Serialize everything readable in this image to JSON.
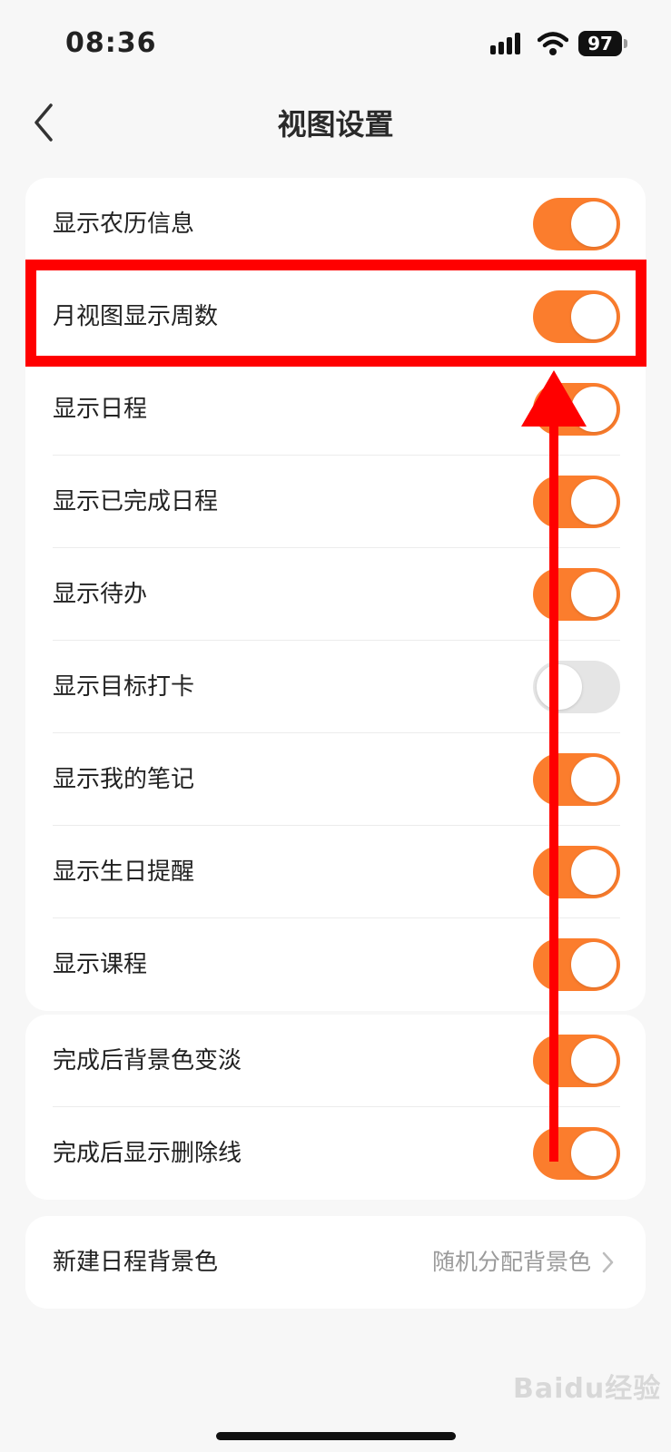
{
  "status_bar": {
    "time": "08:36",
    "battery": "97"
  },
  "nav": {
    "title": "视图设置"
  },
  "group1": [
    {
      "label": "显示农历信息",
      "on": true
    },
    {
      "label": "月视图显示周数",
      "on": true
    },
    {
      "label": "显示日程",
      "on": true
    },
    {
      "label": "显示已完成日程",
      "on": true
    },
    {
      "label": "显示待办",
      "on": true
    },
    {
      "label": "显示目标打卡",
      "on": false
    },
    {
      "label": "显示我的笔记",
      "on": true
    },
    {
      "label": "显示生日提醒",
      "on": true
    },
    {
      "label": "显示课程",
      "on": true
    }
  ],
  "group2": [
    {
      "label": "完成后背景色变淡",
      "on": true
    },
    {
      "label": "完成后显示删除线",
      "on": true
    }
  ],
  "group3": {
    "label": "新建日程背景色",
    "value": "随机分配背景色"
  },
  "watermark": "Baidu经验",
  "colors": {
    "accent": "#fb7d2d",
    "annotation": "#ff0000"
  }
}
